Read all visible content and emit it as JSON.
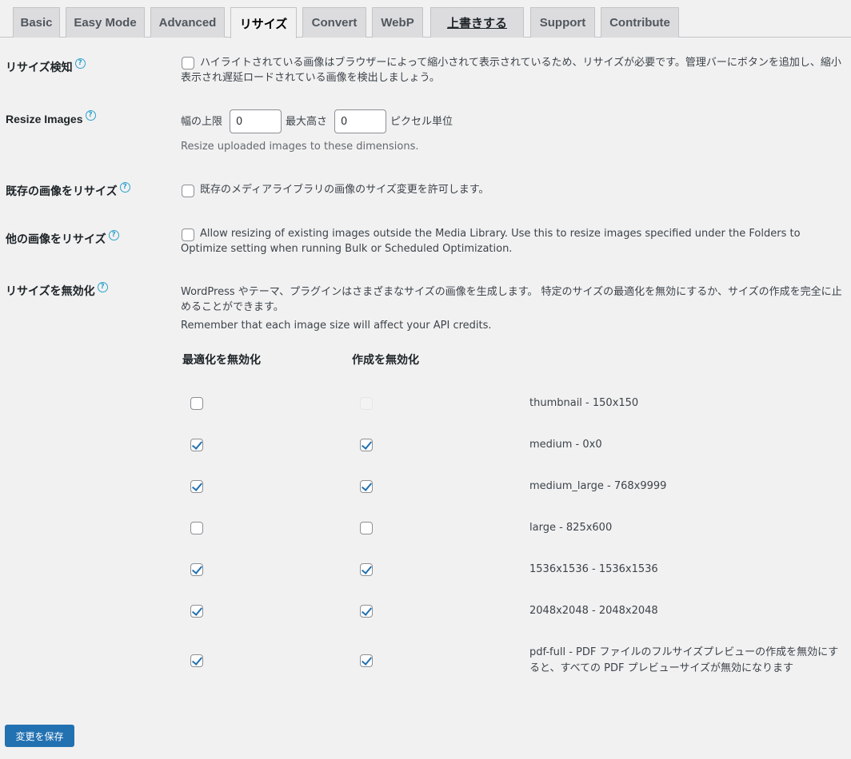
{
  "tabs": [
    {
      "label": "Basic"
    },
    {
      "label": "Easy Mode"
    },
    {
      "label": "Advanced"
    },
    {
      "label": "リサイズ"
    },
    {
      "label": "Convert"
    },
    {
      "label": "WebP"
    },
    {
      "label": "上書きする"
    },
    {
      "label": "Support"
    },
    {
      "label": "Contribute"
    }
  ],
  "help_glyph": "?",
  "resize_detect": {
    "label": "リサイズ検知",
    "checked": false,
    "text": "ハイライトされている画像はブラウザーによって縮小されて表示されているため、リサイズが必要です。管理バーにボタンを追加し、縮小表示され遅延ロードされている画像を検出しましょう。"
  },
  "resize_images": {
    "label": "Resize Images",
    "width_label": "幅の上限",
    "width_value": "0",
    "height_label": "最大高さ",
    "height_value": "0",
    "unit": "ピクセル単位",
    "description": "Resize uploaded images to these dimensions."
  },
  "resize_existing": {
    "label": "既存の画像をリサイズ",
    "checked": false,
    "text": "既存のメディアライブラリの画像のサイズ変更を許可します。"
  },
  "resize_other": {
    "label": "他の画像をリサイズ",
    "checked": false,
    "text": "Allow resizing of existing images outside the Media Library. Use this to resize images specified under the Folders to Optimize setting when running Bulk or Scheduled Optimization."
  },
  "disable_resizes": {
    "label": "リサイズを無効化",
    "intro": "WordPress やテーマ、プラグインはさまざまなサイズの画像を生成します。 特定のサイズの最適化を無効にするか、サイズの作成を完全に止めることができます。",
    "note": "Remember that each image size will affect your API credits.",
    "col_optimize": "最適化を無効化",
    "col_create": "作成を無効化",
    "sizes": [
      {
        "name": "thumbnail - 150x150",
        "optimize": false,
        "create": false,
        "create_disabled": true
      },
      {
        "name": "medium - 0x0",
        "optimize": true,
        "create": true
      },
      {
        "name": "medium_large - 768x9999",
        "optimize": true,
        "create": true
      },
      {
        "name": "large - 825x600",
        "optimize": false,
        "create": false
      },
      {
        "name": "1536x1536 - 1536x1536",
        "optimize": true,
        "create": true
      },
      {
        "name": "2048x2048 - 2048x2048",
        "optimize": true,
        "create": true
      },
      {
        "name": "pdf-full - PDF ファイルのフルサイズプレビューの作成を無効にすると、すべての PDF プレビューサイズが無効になります",
        "optimize": true,
        "create": true
      }
    ]
  },
  "save_label": "変更を保存",
  "colors": {
    "accent": "#2271b1",
    "help": "#2ea2cc",
    "background": "#f1f1f1"
  }
}
